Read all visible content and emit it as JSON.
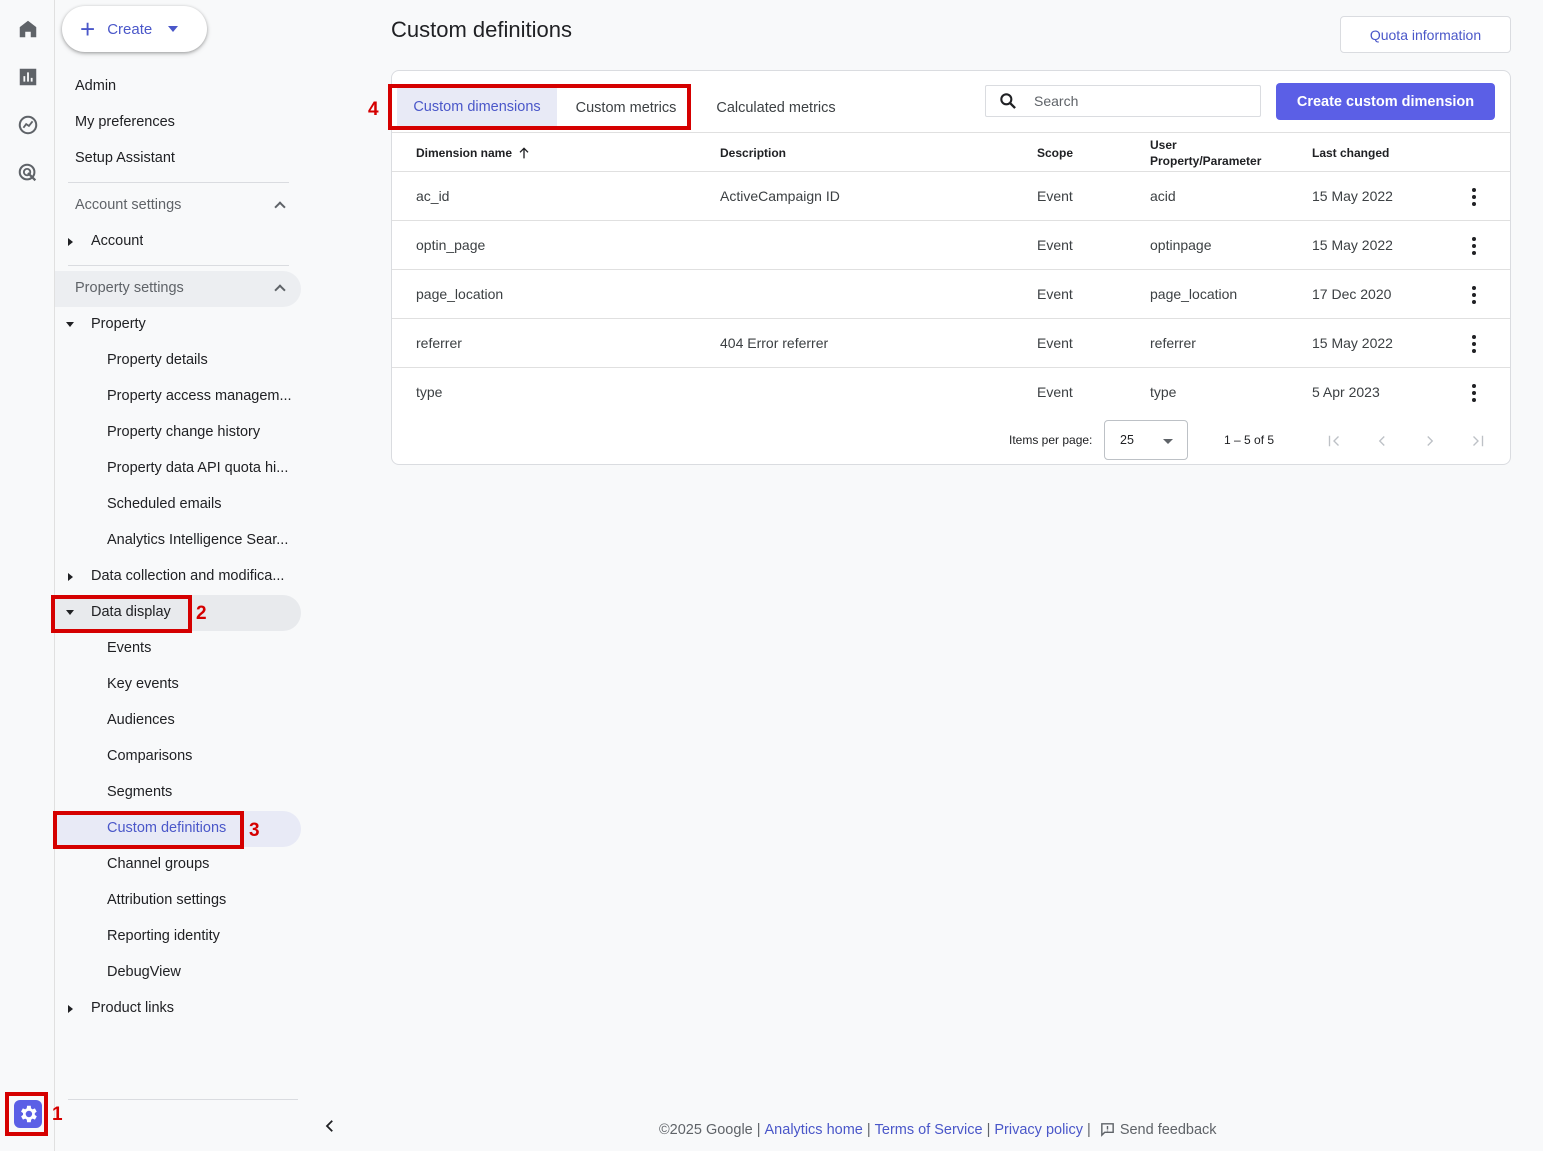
{
  "rail": {
    "icons": [
      "home-icon",
      "reports-icon",
      "explore-icon",
      "advertising-icon"
    ],
    "admin_icon": "gear-icon"
  },
  "sidebar": {
    "create_label": "Create",
    "top_items": [
      "Admin",
      "My preferences",
      "Setup Assistant"
    ],
    "account_settings_label": "Account settings",
    "account_label": "Account",
    "property_settings_label": "Property settings",
    "property_label": "Property",
    "property_children": [
      "Property details",
      "Property access managem...",
      "Property change history",
      "Property data API quota hi...",
      "Scheduled emails",
      "Analytics Intelligence Sear..."
    ],
    "data_collection_label": "Data collection and modifica...",
    "data_display_label": "Data display",
    "data_display_children": [
      "Events",
      "Key events",
      "Audiences",
      "Comparisons",
      "Segments",
      "Custom definitions",
      "Channel groups",
      "Attribution settings",
      "Reporting identity",
      "DebugView"
    ],
    "product_links_label": "Product links"
  },
  "annotations": [
    "1",
    "2",
    "3",
    "4"
  ],
  "main": {
    "title": "Custom definitions",
    "quota_button": "Quota information",
    "tabs": [
      "Custom dimensions",
      "Custom metrics",
      "Calculated metrics"
    ],
    "search_placeholder": "Search",
    "create_button": "Create custom dimension",
    "columns": {
      "name": "Dimension name",
      "description": "Description",
      "scope": "Scope",
      "user_line1": "User",
      "user_line2": "Property/Parameter",
      "last_changed": "Last changed"
    },
    "rows": [
      {
        "name": "ac_id",
        "description": "ActiveCampaign ID",
        "scope": "Event",
        "param": "acid",
        "date": "15 May 2022"
      },
      {
        "name": "optin_page",
        "description": "",
        "scope": "Event",
        "param": "optinpage",
        "date": "15 May 2022"
      },
      {
        "name": "page_location",
        "description": "",
        "scope": "Event",
        "param": "page_location",
        "date": "17 Dec 2020"
      },
      {
        "name": "referrer",
        "description": "404 Error referrer",
        "scope": "Event",
        "param": "referrer",
        "date": "15 May 2022"
      },
      {
        "name": "type",
        "description": "",
        "scope": "Event",
        "param": "type",
        "date": "5 Apr 2023"
      }
    ],
    "pager": {
      "items_per_page_label": "Items per page:",
      "items_per_page_value": "25",
      "range": "1 – 5 of 5"
    }
  },
  "footer": {
    "copyright": "©2025 Google",
    "links": [
      "Analytics home",
      "Terms of Service",
      "Privacy policy"
    ],
    "feedback": "Send feedback"
  },
  "colors": {
    "accent": "#4a57c9",
    "primary_button": "#5b5fe6",
    "annotation_red": "#d50000",
    "active_bg": "#e8eaf6"
  }
}
